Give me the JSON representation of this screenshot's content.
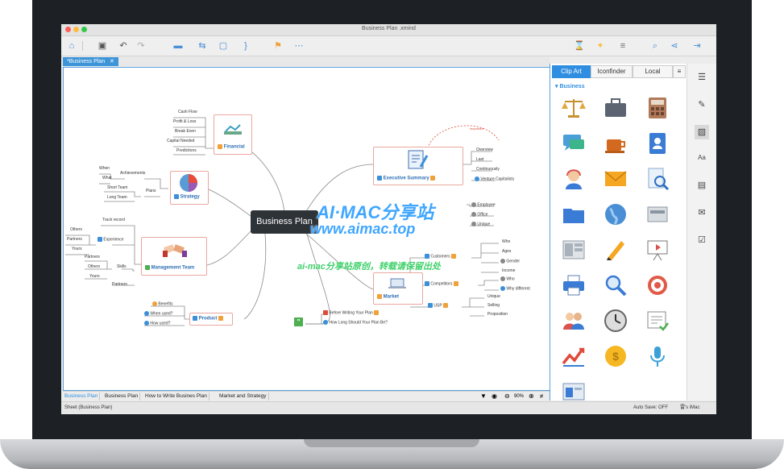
{
  "window": {
    "title": "Business Plan .xmind"
  },
  "doc_tab": {
    "label": "*Business Plan",
    "close": "✕"
  },
  "mindmap": {
    "central": "Business Plan",
    "financial": {
      "label": "Financial",
      "items": [
        "Cash Flow",
        "Profit & Loss",
        "Break Even",
        "Capital Needed",
        "Predictions"
      ]
    },
    "strategy": {
      "label": "Strategy",
      "achievements": "Achievements",
      "plans": "Plans",
      "items": [
        "When",
        "What",
        "Short Team",
        "Long Team"
      ]
    },
    "management": {
      "label": "Management Team",
      "track_record": "Track record",
      "experience": "Experience",
      "skills": "Skills",
      "partners_bottom": "Partners",
      "experience_items": [
        "Others",
        "Partners",
        "Yours"
      ],
      "skills_items": [
        "Partners",
        "Others",
        "Yours"
      ]
    },
    "product": {
      "label": "Product",
      "items": [
        "Benefits",
        "When used?",
        "How used?"
      ]
    },
    "executive": {
      "label": "Executive Summary",
      "items": [
        "Overview",
        "Last",
        "Continuously",
        "Venture Capitalists"
      ],
      "important": "Important"
    },
    "venture_group": {
      "items": [
        "Employee",
        "Office",
        "Unique"
      ]
    },
    "market": {
      "label": "Market",
      "customers": "Customers",
      "competitors": "Competitors",
      "usp": "USP",
      "customer_items": [
        "Who",
        "Ages",
        "Gender",
        "Income"
      ],
      "competitor_items": [
        "Who",
        "Why different"
      ],
      "usp_items": [
        "Unique",
        "Selling",
        "Proposition"
      ]
    },
    "before_writing": "Before Writing Your Plan",
    "how_long": "How Long Should Your Plan Be?"
  },
  "watermark": {
    "line1": "AI·MAC分享站",
    "line2": "www.aimac.top",
    "line3": "ai-mac分享站原创，转载请保留出处"
  },
  "sheets": [
    "Business Plan",
    "Business Plan",
    "How to Write Busines Plan",
    "Market and Strategy"
  ],
  "status": {
    "sheet": "Sheet (Business Plan)",
    "zoom": "90%",
    "autosave": "Auto Save: OFF",
    "user": "雷's iMac"
  },
  "panel": {
    "tabs": [
      "Clip Art",
      "Iconfinder",
      "Local"
    ],
    "category": "Business",
    "clips": [
      "scales",
      "briefcase",
      "calculator",
      "chat",
      "coffee",
      "contacts",
      "support",
      "mail",
      "search-doc",
      "folder",
      "globe",
      "drawer",
      "layout",
      "pencil",
      "presentation",
      "printer",
      "magnifier",
      "target",
      "team",
      "clock",
      "certificate",
      "chart",
      "coin",
      "microphone",
      "window"
    ]
  },
  "colors": {
    "accent": "#2f8ee0",
    "topic_border": "#e9a7a0",
    "central_bg": "#2e3338"
  }
}
